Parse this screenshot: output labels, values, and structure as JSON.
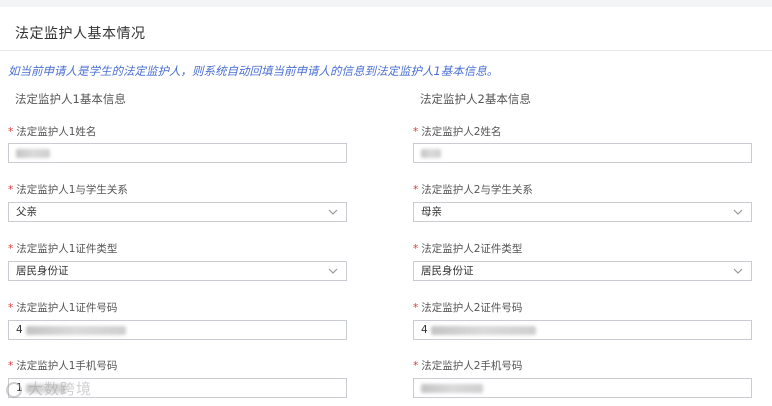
{
  "section": {
    "title": "法定监护人基本情况",
    "note": "如当前申请人是学生的法定监护人，则系统自动回填当前申请人的信息到法定监护人1基本信息。"
  },
  "guardian1": {
    "heading": "法定监护人1基本信息",
    "name_label": "法定监护人1姓名",
    "relation_label": "法定监护人1与学生关系",
    "relation_value": "父亲",
    "id_type_label": "法定监护人1证件类型",
    "id_type_value": "居民身份证",
    "id_number_label": "法定监护人1证件号码",
    "id_number_prefix": "4",
    "phone_label": "法定监护人1手机号码",
    "phone_prefix": "1"
  },
  "guardian2": {
    "heading": "法定监护人2基本信息",
    "name_label": "法定监护人2姓名",
    "relation_label": "法定监护人2与学生关系",
    "relation_value": "母亲",
    "id_type_label": "法定监护人2证件类型",
    "id_type_value": "居民身份证",
    "id_number_label": "法定监护人2证件号码",
    "id_number_prefix": "4",
    "phone_label": "法定监护人2手机号码"
  },
  "required_mark": "*",
  "watermark": "大数跨境",
  "icons": {
    "dropdown": "chevron-down-icon",
    "watermark_logo": "watermark-logo-icon"
  },
  "colors": {
    "required": "#e0363b",
    "note": "#4a6fd4",
    "input_border": "#c9ccd2"
  }
}
